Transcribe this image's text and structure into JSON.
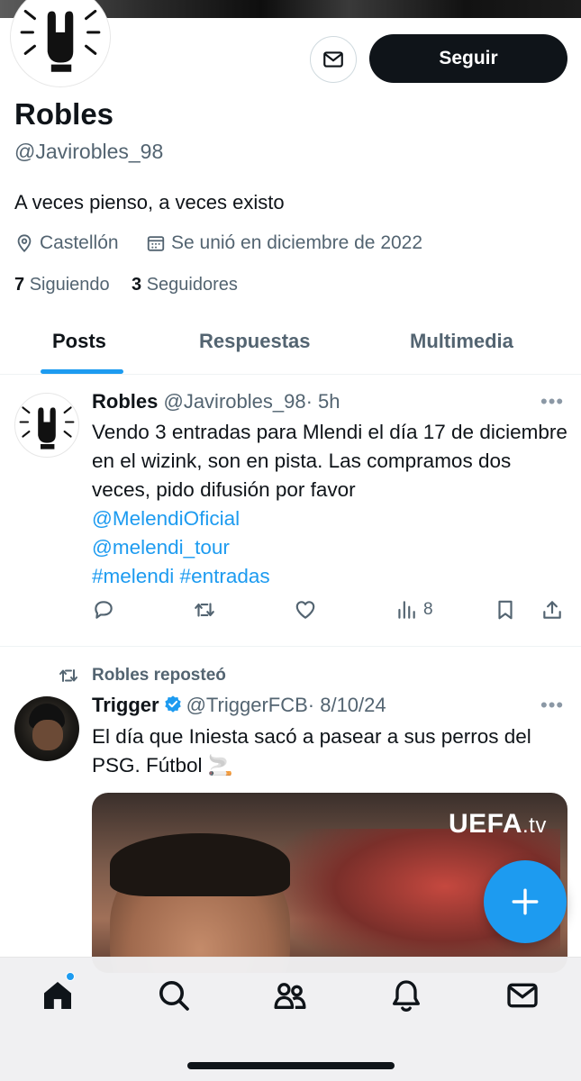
{
  "profile": {
    "name": "Robles",
    "handle": "@Javirobles_98",
    "bio": "A veces pienso, a veces existo",
    "location": "Castellón",
    "joined": "Se unió en diciembre de 2022",
    "following_count": "7",
    "following_label": "Siguiendo",
    "followers_count": "3",
    "followers_label": "Seguidores",
    "follow_button": "Seguir"
  },
  "tabs": [
    {
      "label": "Posts",
      "active": true
    },
    {
      "label": "Respuestas",
      "active": false
    },
    {
      "label": "Multimedia",
      "active": false
    }
  ],
  "posts": [
    {
      "author": "Robles",
      "handle": "@Javirobles_98",
      "time": "· 5h",
      "text": "Vendo 3 entradas para Mlendi el día 17 de diciembre en el wizink, son en pista. Las compramos dos veces, pido difusión por favor",
      "mention1": "@MelendiOficial",
      "mention2": "@melendi_tour",
      "hashtags": "#melendi #entradas",
      "views": "8"
    },
    {
      "repost_label": "Robles reposteó",
      "author": "Trigger",
      "handle": "@TriggerFCB",
      "time": "· 8/10/24",
      "text": "El día que Iniesta sacó a pasear a sus perros del PSG. Fútbol 🚬",
      "media_watermark_main": "UEFA",
      "media_watermark_suffix": ".tv"
    }
  ],
  "colors": {
    "accent": "#1d9bf0",
    "text": "#0f1419",
    "muted": "#536471"
  },
  "icons": [
    "mail-icon",
    "location-icon",
    "calendar-icon",
    "reply-icon",
    "retweet-icon",
    "like-icon",
    "views-icon",
    "bookmark-icon",
    "share-icon",
    "verified-icon",
    "plus-icon",
    "home-icon",
    "search-icon",
    "communities-icon",
    "notifications-icon",
    "messages-icon"
  ]
}
